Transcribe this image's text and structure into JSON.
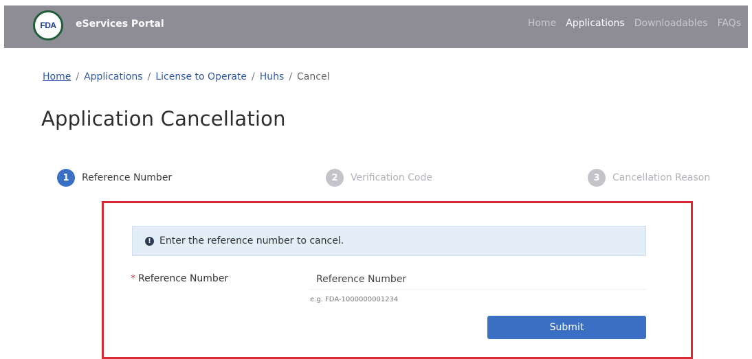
{
  "header": {
    "logo_text": "FDA",
    "brand": "eServices Portal",
    "nav": [
      {
        "label": "Home",
        "active": false
      },
      {
        "label": "Applications",
        "active": true
      },
      {
        "label": "Downloadables",
        "active": false
      },
      {
        "label": "FAQs",
        "active": false
      }
    ]
  },
  "breadcrumb": {
    "items": [
      "Home",
      "Applications",
      "License to Operate",
      "Huhs",
      "Cancel"
    ],
    "separator": "/"
  },
  "page": {
    "title": "Application Cancellation"
  },
  "steps": [
    {
      "number": "1",
      "label": "Reference Number",
      "active": true
    },
    {
      "number": "2",
      "label": "Verification Code",
      "active": false
    },
    {
      "number": "3",
      "label": "Cancellation Reason",
      "active": false
    }
  ],
  "form": {
    "info_icon": "!",
    "info_message": "Enter the reference number to cancel.",
    "required_mark": "*",
    "field_label": "Reference Number",
    "input_value": "",
    "input_placeholder": "Reference Number",
    "hint": "e.g. FDA-1000000001234",
    "submit_label": "Submit"
  },
  "colors": {
    "navbar": "#8e8d95",
    "primary": "#3a6fc3",
    "highlight_frame": "#d82a33",
    "alert_bg": "#e3eef9",
    "logo_ring": "#1f5e39"
  }
}
